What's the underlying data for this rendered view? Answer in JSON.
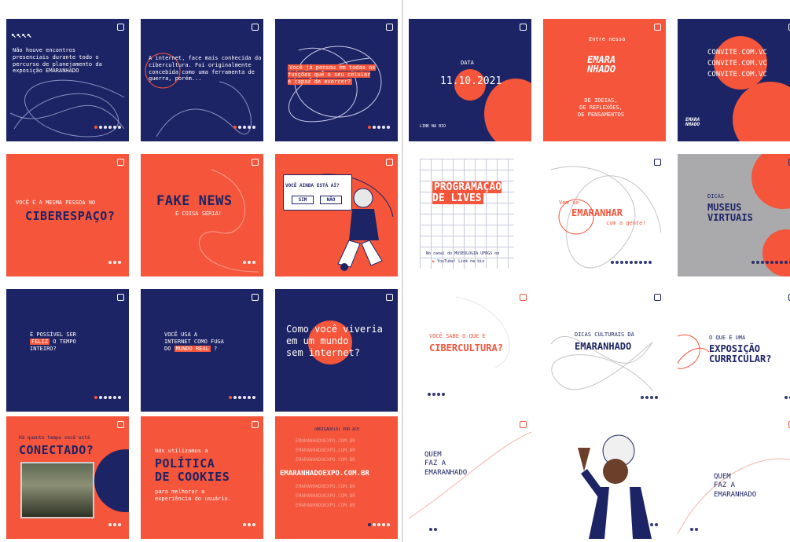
{
  "colors": {
    "navy": "#1d2465",
    "orange": "#f4553b",
    "white": "#ffffff",
    "gray": "#aaaaac"
  },
  "left": {
    "r1c1": {
      "text": "Não houve encontros\npresenciais durante todo o\npercurso de planejamento da\nexposição EMARANHADO"
    },
    "r1c2": {
      "text": "A internet, face mais conhecida da\ncibercultura. Foi originalmente\nconcebida como uma ferramenta de\nguerra, porém..."
    },
    "r1c3": {
      "text": "Você já pensou em todas as\nfunções que o seu celular\né capaz de exercer?"
    },
    "r2c1": {
      "line1": "VOCÊ É A MESMA PESSOA NO",
      "line2": "CIBERESPAÇO?"
    },
    "r2c2": {
      "title": "FAKE NEWS",
      "sub": "É COISA SÉRIA!"
    },
    "r2c3": {
      "question": "VOCÊ AINDA ESTÁ AÍ?",
      "yes": "SIM",
      "no": "NÃO"
    },
    "r3c1": {
      "pre": "É POSSÍVEL SER",
      "hl": "FELIZ",
      "post": "O TEMPO\nINTEIRO?"
    },
    "r3c2": {
      "pre": "VOCÊ USA A\nINTERNET COMO FUGA\nDO",
      "hl": "MUNDO REAL",
      "post": "?"
    },
    "r3c3": {
      "text": "Como você viveria\nem um mundo\nsem internet?"
    },
    "r4c1": {
      "small": "Há quanto tempo você está",
      "title": "CONECTADO?"
    },
    "r4c2": {
      "small": "Nós utilizamos a",
      "title": "POLÍTICA\nDE COOKIES",
      "sub": "para melhorar a\nexperiência do usuário."
    },
    "r4c3": {
      "top": "OBRIGADO(A) POR ACE",
      "main": "EMARANHADOEXPO.COM.BR",
      "repeat": "EMARANHADOEXPO.COM.BR"
    }
  },
  "right": {
    "r1c1": {
      "label": "DATA",
      "date": "11.10.2021",
      "link": "LINK NA BIO"
    },
    "r1c2": {
      "top": "Entre nessa",
      "logo": "EMARA\nNHADO",
      "sub": "DE IDEIAS,\nDE REFLEXÕES,\nDE PENSAMENTOS"
    },
    "r1c3": {
      "lines": [
        "CONVITE.COM.VC",
        "CONVITE.COM.VC",
        "CONVITE.COM.VC"
      ],
      "logo": "EMARA\nNHADO"
    },
    "r2c1": {
      "title": "PROGRAMAÇÃO\nDE LIVES",
      "sub": "No canal do MUSEOLOGIA UFRGS no",
      "yt": "YouTube! Link na bio"
    },
    "r2c2": {
      "pre": "Vem se",
      "title": "EMARANHAR",
      "post": "com a gente!"
    },
    "r2c3": {
      "small": "DICAS",
      "title": "MUSEUS\nVIRTUAIS"
    },
    "r3c1": {
      "small": "VOCÊ SABE O QUE É",
      "title": "CIBERCULTURA?"
    },
    "r3c2": {
      "small": "DICAS CULTURAIS DA",
      "title": "EMARANHADO"
    },
    "r3c3": {
      "small": "O QUE É UMA",
      "title": "EXPOSIÇÃO\nCURRICULAR?"
    },
    "r4c1": {
      "text": "QUEM\nFAZ A\nEMARANHADO"
    },
    "r4c3": {
      "text": "QUEM\nFAZ A\nEMARANHADO"
    }
  }
}
